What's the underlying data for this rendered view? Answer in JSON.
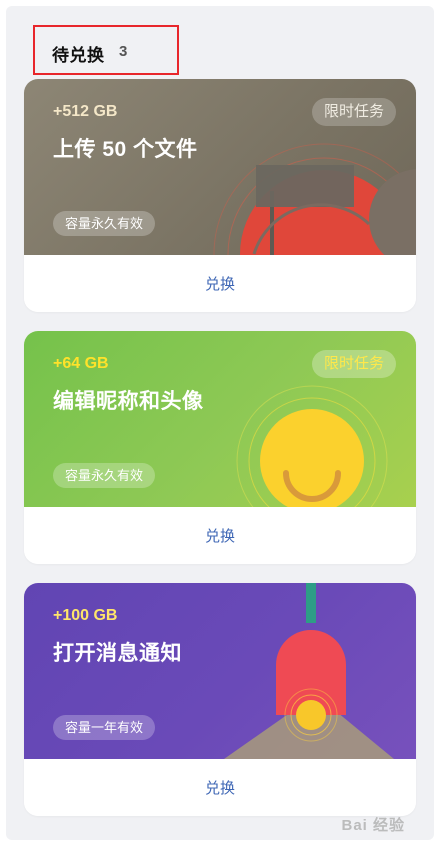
{
  "header": {
    "title": "待兑换",
    "count": "3"
  },
  "cards": [
    {
      "amount": "+512 GB",
      "title": "上传 50 个文件",
      "badge": "限时任务",
      "validity": "容量永久有效",
      "action": "兑换"
    },
    {
      "amount": "+64 GB",
      "title": "编辑昵称和头像",
      "badge": "限时任务",
      "validity": "容量永久有效",
      "action": "兑换"
    },
    {
      "amount": "+100 GB",
      "title": "打开消息通知",
      "validity": "容量一年有效",
      "action": "兑换"
    }
  ],
  "watermark": "Bai 经验",
  "colors": {
    "panel_bg": "#f0f1f4",
    "header_box": "#e8262b",
    "redeem_link": "#3f67b5",
    "card1_bg": "#7d7666",
    "card2_bg": "#86c650",
    "card3_bg": "#6748b6"
  },
  "icons": [
    "flag-icon",
    "smiley-icon",
    "lamp-icon"
  ]
}
